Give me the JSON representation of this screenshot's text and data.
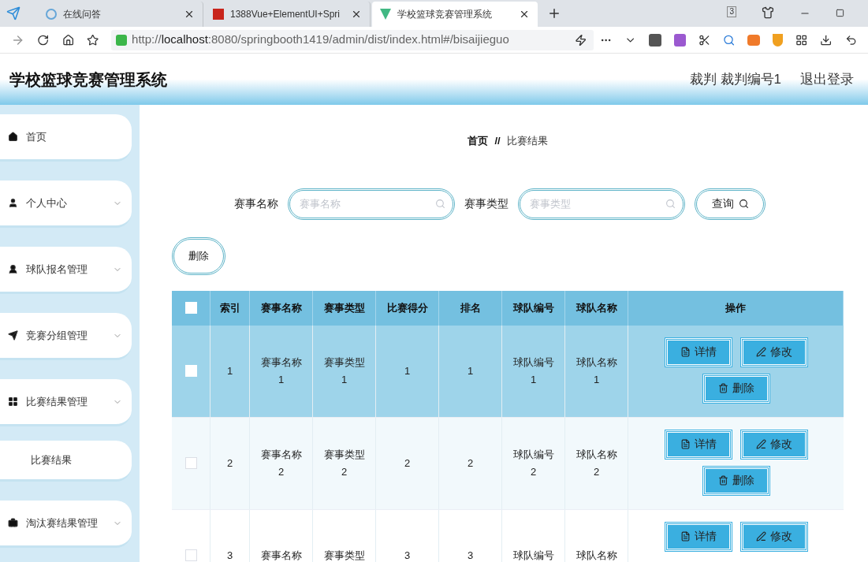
{
  "browser": {
    "tabs": [
      {
        "title": "在线问答",
        "selected": false
      },
      {
        "title": "1388Vue+ElementUI+Spri",
        "selected": false
      },
      {
        "title": "学校篮球竞赛管理系统",
        "selected": true
      }
    ],
    "tab_count": "3",
    "url_prefix": "http://",
    "url_host": "localhost",
    "url_rest": ":8080/springbooth1419/admin/dist/index.html#/bisaijieguo"
  },
  "header": {
    "title": "学校篮球竞赛管理系统",
    "user": "裁判 裁判编号1",
    "logout": "退出登录"
  },
  "sidebar": {
    "items": [
      {
        "label": "首页",
        "expandable": false
      },
      {
        "label": "个人中心",
        "expandable": true
      },
      {
        "label": "球队报名管理",
        "expandable": true
      },
      {
        "label": "竞赛分组管理",
        "expandable": true
      },
      {
        "label": "比赛结果管理",
        "expandable": true,
        "children": [
          {
            "label": "比赛结果"
          }
        ]
      },
      {
        "label": "淘汰赛结果管理",
        "expandable": true
      }
    ]
  },
  "breadcrumb": {
    "home": "首页",
    "separator": "//",
    "current": "比赛结果"
  },
  "search": {
    "fields": [
      {
        "label": "赛事名称",
        "placeholder": "赛事名称"
      },
      {
        "label": "赛事类型",
        "placeholder": "赛事类型"
      }
    ],
    "button": "查询"
  },
  "delete_button": "删除",
  "table": {
    "all_checked": false,
    "columns": [
      "索引",
      "赛事名称",
      "赛事类型",
      "比赛得分",
      "排名",
      "球队编号",
      "球队名称",
      "操作"
    ],
    "rows": [
      {
        "highlighted": true,
        "checked": false,
        "cells": [
          [
            "1"
          ],
          [
            "赛事名称",
            "1"
          ],
          [
            "赛事类型",
            "1"
          ],
          [
            "1"
          ],
          [
            "1"
          ],
          [
            "球队编号",
            "1"
          ],
          [
            "球队名称",
            "1"
          ]
        ],
        "actions": [
          "详情",
          "修改",
          "删除"
        ]
      },
      {
        "highlighted": false,
        "checked": false,
        "cells": [
          [
            "2"
          ],
          [
            "赛事名称",
            "2"
          ],
          [
            "赛事类型",
            "2"
          ],
          [
            "2"
          ],
          [
            "2"
          ],
          [
            "球队编号",
            "2"
          ],
          [
            "球队名称",
            "2"
          ]
        ],
        "actions": [
          "详情",
          "修改",
          "删除"
        ]
      },
      {
        "highlighted": false,
        "checked": false,
        "cells": [
          [
            "3"
          ],
          [
            "赛事名称"
          ],
          [
            "赛事类型"
          ],
          [
            "3"
          ],
          [
            "3"
          ],
          [
            "球队编号"
          ],
          [
            "球队名称"
          ]
        ],
        "actions": [
          "详情",
          "修改"
        ]
      }
    ]
  }
}
